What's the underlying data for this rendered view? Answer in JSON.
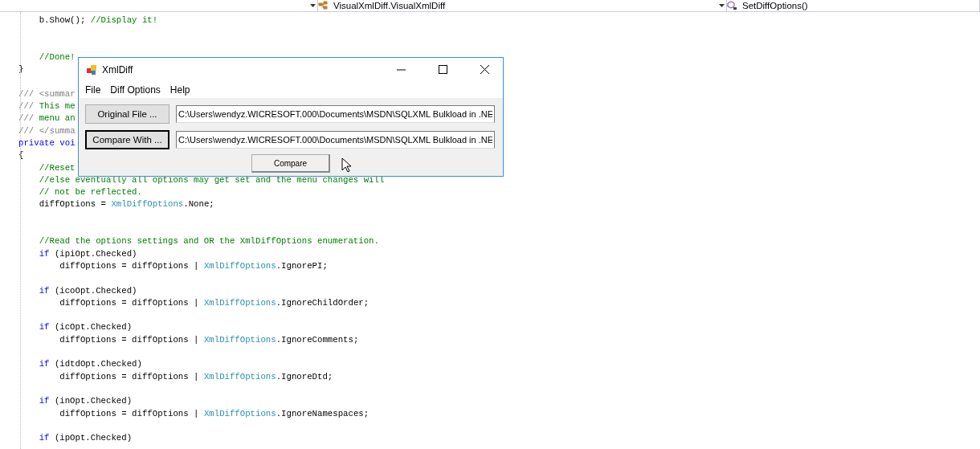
{
  "navigation_bar": {
    "dropdowns": [
      {
        "text": "VisualXmlDiff.VisualXmlDiff"
      },
      {
        "text": "SetDiffOptions()"
      }
    ]
  },
  "code_lines": [
    {
      "kind": "code",
      "tokens": [
        {
          "kind": "plain",
          "text": "    b.Show(); "
        },
        {
          "kind": "comment",
          "text": "//Display it!"
        }
      ]
    },
    {
      "kind": "blank"
    },
    {
      "kind": "blank"
    },
    {
      "kind": "code",
      "tokens": [
        {
          "kind": "comment",
          "text": "    //Done!"
        }
      ]
    },
    {
      "kind": "code",
      "tokens": [
        {
          "kind": "plain",
          "text": "}"
        }
      ]
    },
    {
      "kind": "blank"
    },
    {
      "kind": "code",
      "tokens": [
        {
          "kind": "doc",
          "text": "/// <summar"
        }
      ]
    },
    {
      "kind": "code",
      "tokens": [
        {
          "kind": "doc",
          "text": "/// "
        },
        {
          "kind": "comment",
          "text": "This me"
        }
      ]
    },
    {
      "kind": "code",
      "tokens": [
        {
          "kind": "doc",
          "text": "/// "
        },
        {
          "kind": "comment",
          "text": "menu an"
        }
      ]
    },
    {
      "kind": "code",
      "tokens": [
        {
          "kind": "doc",
          "text": "/// </summa"
        }
      ]
    },
    {
      "kind": "code",
      "tokens": [
        {
          "kind": "keyword",
          "text": "private voi"
        }
      ]
    },
    {
      "kind": "code",
      "tokens": [
        {
          "kind": "plain",
          "text": "{"
        }
      ]
    },
    {
      "kind": "code",
      "tokens": [
        {
          "kind": "comment",
          "text": "    //Reset"
        }
      ]
    },
    {
      "kind": "code",
      "tokens": [
        {
          "kind": "comment",
          "text": "    //else eventually all options may get set and the menu changes will"
        }
      ]
    },
    {
      "kind": "code",
      "tokens": [
        {
          "kind": "comment",
          "text": "    // not be reflected."
        }
      ]
    },
    {
      "kind": "code",
      "tokens": [
        {
          "kind": "plain",
          "text": "    diffOptions = "
        },
        {
          "kind": "type",
          "text": "XmlDiffOptions"
        },
        {
          "kind": "plain",
          "text": ".None;"
        }
      ]
    },
    {
      "kind": "blank"
    },
    {
      "kind": "blank"
    },
    {
      "kind": "code",
      "tokens": [
        {
          "kind": "comment",
          "text": "    //Read the options settings and OR the XmlDiffOptions enumeration."
        }
      ]
    },
    {
      "kind": "code",
      "tokens": [
        {
          "kind": "keyword",
          "text": "    if"
        },
        {
          "kind": "plain",
          "text": " (ipiOpt.Checked)"
        }
      ]
    },
    {
      "kind": "code",
      "tokens": [
        {
          "kind": "plain",
          "text": "        diffOptions = diffOptions | "
        },
        {
          "kind": "type",
          "text": "XmlDiffOptions"
        },
        {
          "kind": "plain",
          "text": ".IgnorePI;"
        }
      ]
    },
    {
      "kind": "blank"
    },
    {
      "kind": "code",
      "tokens": [
        {
          "kind": "keyword",
          "text": "    if"
        },
        {
          "kind": "plain",
          "text": " (icoOpt.Checked)"
        }
      ]
    },
    {
      "kind": "code",
      "tokens": [
        {
          "kind": "plain",
          "text": "        diffOptions = diffOptions | "
        },
        {
          "kind": "type",
          "text": "XmlDiffOptions"
        },
        {
          "kind": "plain",
          "text": ".IgnoreChildOrder;"
        }
      ]
    },
    {
      "kind": "blank"
    },
    {
      "kind": "code",
      "tokens": [
        {
          "kind": "keyword",
          "text": "    if"
        },
        {
          "kind": "plain",
          "text": " (icOpt.Checked)"
        }
      ]
    },
    {
      "kind": "code",
      "tokens": [
        {
          "kind": "plain",
          "text": "        diffOptions = diffOptions | "
        },
        {
          "kind": "type",
          "text": "XmlDiffOptions"
        },
        {
          "kind": "plain",
          "text": ".IgnoreComments;"
        }
      ]
    },
    {
      "kind": "blank"
    },
    {
      "kind": "code",
      "tokens": [
        {
          "kind": "keyword",
          "text": "    if"
        },
        {
          "kind": "plain",
          "text": " (idtdOpt.Checked)"
        }
      ]
    },
    {
      "kind": "code",
      "tokens": [
        {
          "kind": "plain",
          "text": "        diffOptions = diffOptions | "
        },
        {
          "kind": "type",
          "text": "XmlDiffOptions"
        },
        {
          "kind": "plain",
          "text": ".IgnoreDtd;"
        }
      ]
    },
    {
      "kind": "blank"
    },
    {
      "kind": "code",
      "tokens": [
        {
          "kind": "keyword",
          "text": "    if"
        },
        {
          "kind": "plain",
          "text": " (inOpt.Checked)"
        }
      ]
    },
    {
      "kind": "code",
      "tokens": [
        {
          "kind": "plain",
          "text": "        diffOptions = diffOptions | "
        },
        {
          "kind": "type",
          "text": "XmlDiffOptions"
        },
        {
          "kind": "plain",
          "text": ".IgnoreNamespaces;"
        }
      ]
    },
    {
      "kind": "blank"
    },
    {
      "kind": "code",
      "tokens": [
        {
          "kind": "keyword",
          "text": "    if"
        },
        {
          "kind": "plain",
          "text": " (ipOpt.Checked)"
        }
      ]
    }
  ],
  "dialog": {
    "title": "XmlDiff",
    "menu": [
      "File",
      "Diff Options",
      "Help"
    ],
    "file_rows": [
      {
        "button": "Original File ...",
        "focused": false,
        "path": "C:\\Users\\wendyz.WICRESOFT.000\\Documents\\MSDN\\SQLXML Bulkload in .NE"
      },
      {
        "button": "Compare With ...",
        "focused": true,
        "path": "C:\\Users\\wendyz.WICRESOFT.000\\Documents\\MSDN\\SQLXML Bulkload in .NE"
      }
    ],
    "compare_button": "Compare"
  }
}
